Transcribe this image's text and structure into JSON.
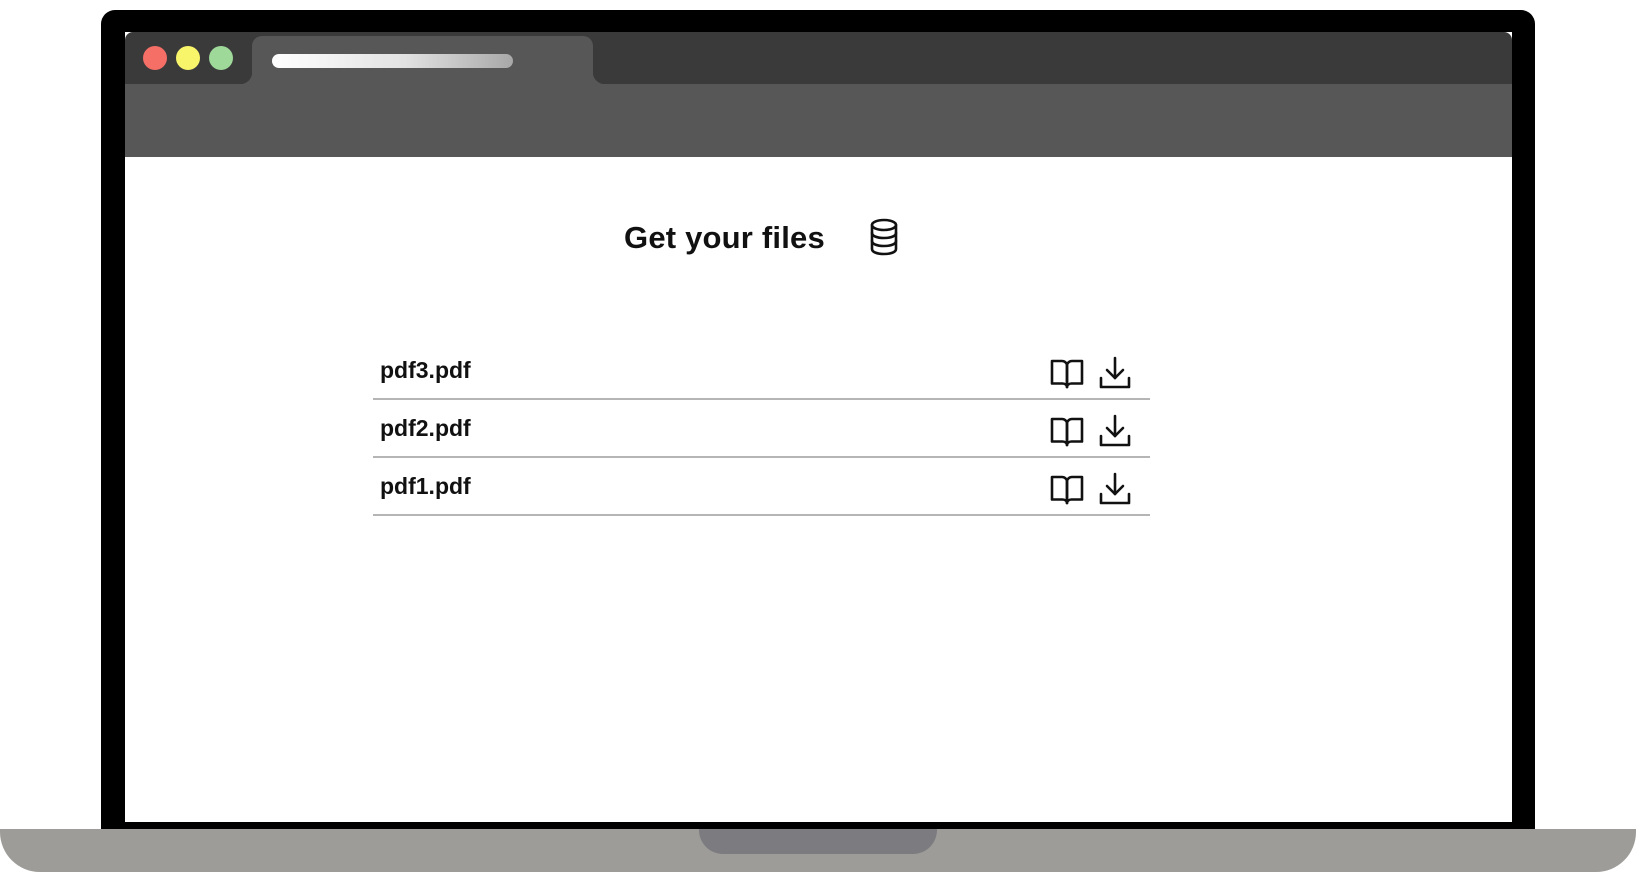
{
  "page": {
    "title": "Get your files",
    "header_icon": "database-icon"
  },
  "files": [
    {
      "name": "pdf3.pdf",
      "read_icon": "book-open-icon",
      "download_icon": "download-icon"
    },
    {
      "name": "pdf2.pdf",
      "read_icon": "book-open-icon",
      "download_icon": "download-icon"
    },
    {
      "name": "pdf1.pdf",
      "read_icon": "book-open-icon",
      "download_icon": "download-icon"
    }
  ],
  "colors": {
    "traffic_close": "#f56f67",
    "traffic_minimize": "#f9f56b",
    "traffic_maximize": "#9fd99a",
    "chrome_dark": "#3a3a3a",
    "chrome_toolbar": "#575757",
    "laptop_bezel": "#000000",
    "laptop_base": "#9d9c98",
    "row_divider": "#b5b5b5"
  }
}
